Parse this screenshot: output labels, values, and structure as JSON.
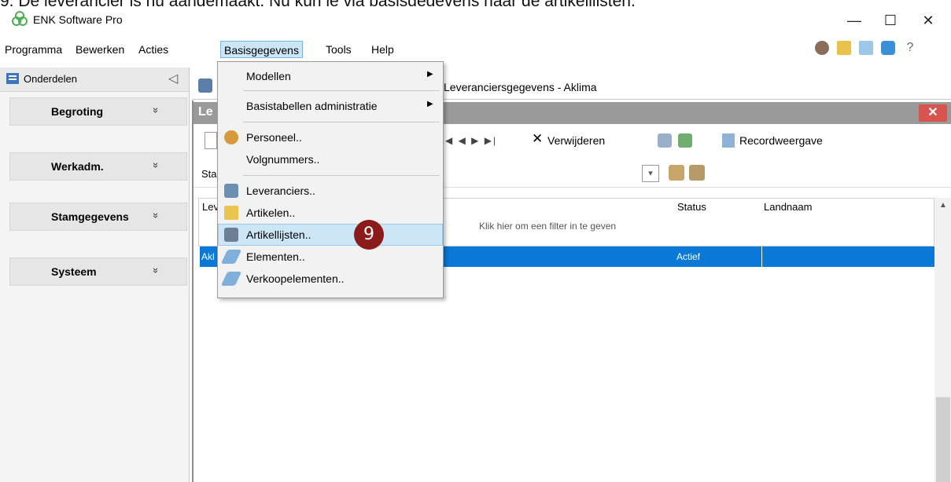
{
  "caption": "9.   De leverancier is nu aangemaakt. Nu kun je via basisgegevens naar de artikellijsten.",
  "window": {
    "title": "ENK Software Pro",
    "minimize": "—",
    "maximize": "☐",
    "close": "✕"
  },
  "menubar": {
    "items": [
      "Programma",
      "Bewerken",
      "Acties",
      "Basisgegevens",
      "Tools",
      "Help"
    ]
  },
  "leftpanel": {
    "title": "Onderdelen",
    "collapse": "◁",
    "groups": [
      "Begroting",
      "Werkadm.",
      "Stamgegevens",
      "Systeem"
    ],
    "chevron": "»"
  },
  "document": {
    "tab_label": "Leveranciersgegevens - Aklima",
    "header_title": "Le",
    "close": "✕",
    "toolbar": {
      "nav": "◀  ◀  ▶  ▶|",
      "delete_icon": "✕",
      "delete": "Verwijderen",
      "record_view": "Recordweergave"
    },
    "filter_label": "Sta",
    "grid": {
      "col_first": "Lev",
      "col_status": "Status",
      "col_country": "Landnaam",
      "filter_hint": "Klik hier om een filter in te geven",
      "row": {
        "name": "Akl",
        "status": "Actief"
      }
    }
  },
  "dropdown": {
    "items": [
      {
        "label": "Modellen",
        "submenu": true
      },
      {
        "label": "Basistabellen administratie",
        "submenu": true
      },
      {
        "label": "Personeel.."
      },
      {
        "label": "Volgnummers.."
      },
      {
        "label": "Leveranciers.."
      },
      {
        "label": "Artikelen.."
      },
      {
        "label": "Artikellijsten..",
        "highlighted": true
      },
      {
        "label": "Elementen.."
      },
      {
        "label": "Verkoopelementen.."
      }
    ]
  },
  "step_badge": "9",
  "colors": {
    "accent": "#0a78d7",
    "badge": "#8b1a1a",
    "highlight": "#cde6f7"
  }
}
